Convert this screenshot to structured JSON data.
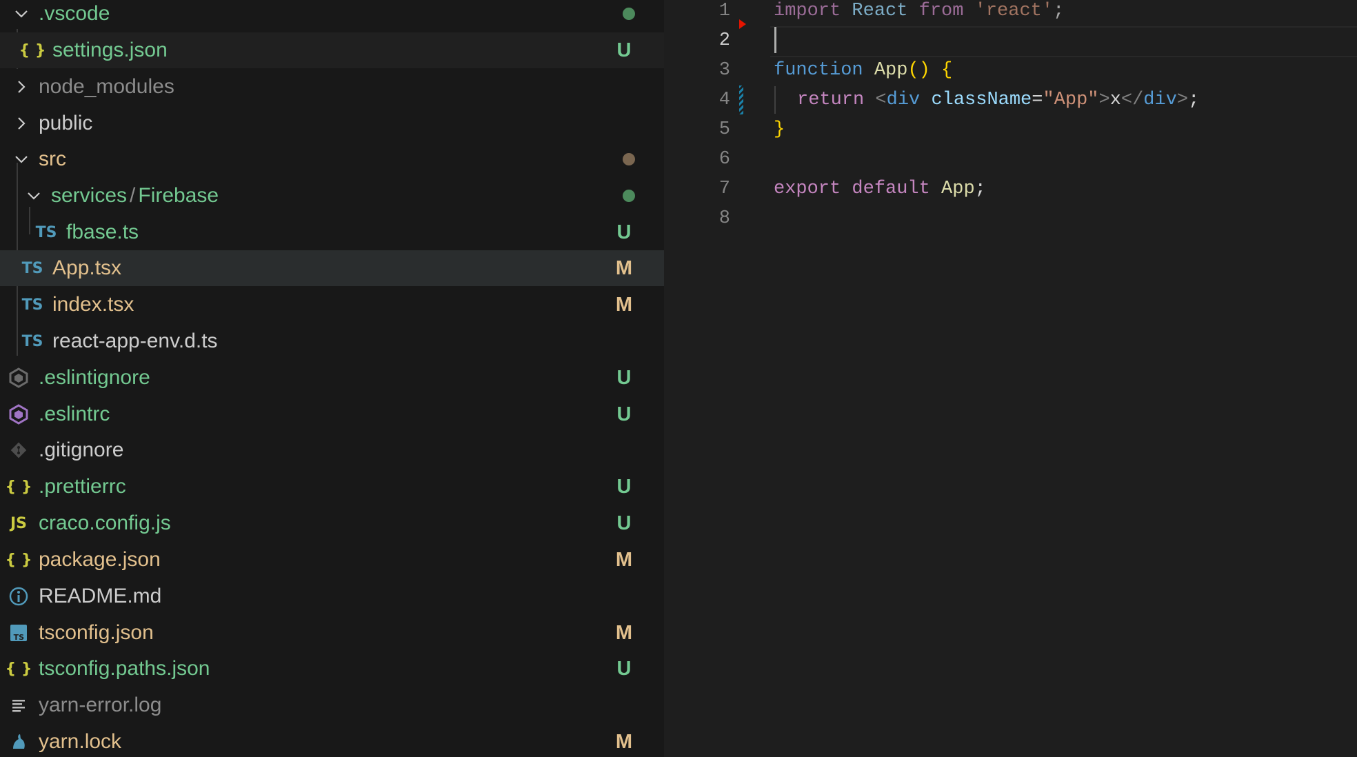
{
  "explorer": {
    "rows": [
      {
        "label": ".vscode",
        "badge": ""
      },
      {
        "label": "settings.json",
        "badge": "U"
      },
      {
        "label": "node_modules",
        "badge": ""
      },
      {
        "label": "public",
        "badge": ""
      },
      {
        "label": "src",
        "badge": ""
      },
      {
        "label_a": "services",
        "separator": "/",
        "label_b": "Firebase",
        "badge": ""
      },
      {
        "label": "fbase.ts",
        "badge": "U"
      },
      {
        "label": "App.tsx",
        "badge": "M"
      },
      {
        "label": "index.tsx",
        "badge": "M"
      },
      {
        "label": "react-app-env.d.ts",
        "badge": ""
      },
      {
        "label": ".eslintignore",
        "badge": "U"
      },
      {
        "label": ".eslintrc",
        "badge": "U"
      },
      {
        "label": ".gitignore",
        "badge": ""
      },
      {
        "label": ".prettierrc",
        "badge": "U"
      },
      {
        "label": "craco.config.js",
        "badge": "U"
      },
      {
        "label": "package.json",
        "badge": "M"
      },
      {
        "label": "README.md",
        "badge": ""
      },
      {
        "label": "tsconfig.json",
        "badge": "M"
      },
      {
        "label": "tsconfig.paths.json",
        "badge": "U"
      },
      {
        "label": "yarn-error.log",
        "badge": ""
      },
      {
        "label": "yarn.lock",
        "badge": "M"
      }
    ],
    "icon_text": {
      "json": "{ }",
      "ts": "TS",
      "js": "JS"
    },
    "colors": {
      "untracked": "#73c991",
      "modified": "#e2c08d",
      "dot_green": "#4c8a5c",
      "dot_brown": "#7a6650",
      "ts_blue": "#519aba",
      "js_yellow": "#cbcb41",
      "eslint_purple": "#a074c4"
    }
  },
  "editor": {
    "line_numbers": [
      "1",
      "2",
      "3",
      "4",
      "5",
      "6",
      "7",
      "8"
    ],
    "current_line": "2",
    "code": {
      "l1": {
        "kw1": "import",
        "id": "React",
        "kw2": "from",
        "str": "'react'",
        "semi": ";"
      },
      "l3": {
        "kw": "function",
        "name": "App",
        "paren": "()",
        "brace": "{"
      },
      "l4": {
        "kw": "return",
        "lt": "<",
        "tag": "div",
        "attr": "className",
        "eq": "=",
        "val": "\"App\"",
        "gt": ">",
        "text": "x",
        "ltslash": "</",
        "tag2": "div",
        "gt2": ">",
        "semi": ";"
      },
      "l5": {
        "brace": "}"
      },
      "l7": {
        "kw1": "export",
        "kw2": "default",
        "name": "App",
        "semi": ";"
      }
    }
  }
}
